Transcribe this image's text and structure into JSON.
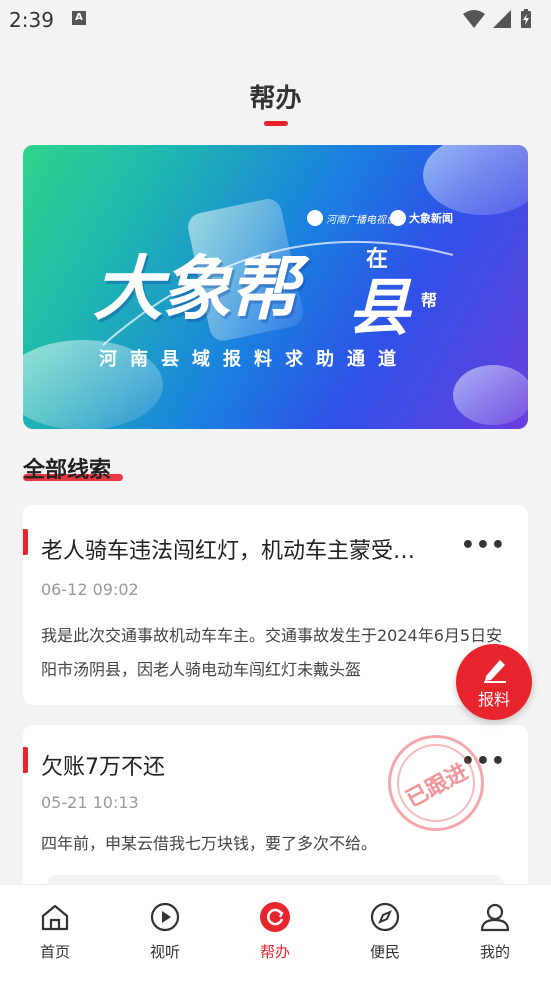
{
  "status_bar": {
    "time": "2:39",
    "notification_badge": "A"
  },
  "header": {
    "title": "帮办"
  },
  "banner": {
    "logo_left": "河南广播电视台",
    "logo_right": "大象新闻",
    "headline": "大象帮",
    "headline_tag_1": "在",
    "headline_tag_2": "县",
    "headline_tag_3": "帮",
    "subtitle": "河南县域报料求助通道"
  },
  "section": {
    "title": "全部线索"
  },
  "cards": [
    {
      "title": "老人骑车违法闯红灯，机动车主蒙受…",
      "time": "06-12 09:02",
      "body": "我是此次交通事故机动车车主。交通事故发生于2024年6月5日安阳市汤阴县，因老人骑电动车闯红灯未戴头盔",
      "more": "•••"
    },
    {
      "title": "欠账7万不还",
      "time": "05-21 10:13",
      "body": "四年前，申某云借我七万块钱，要了多次不给。",
      "more": "•••",
      "stamp": "已跟进"
    }
  ],
  "fab": {
    "label": "报料"
  },
  "tabs": [
    {
      "label": "首页",
      "icon": "home-icon",
      "active": false
    },
    {
      "label": "视听",
      "icon": "play-icon",
      "active": false
    },
    {
      "label": "帮办",
      "icon": "help-icon",
      "active": true
    },
    {
      "label": "便民",
      "icon": "compass-icon",
      "active": false
    },
    {
      "label": "我的",
      "icon": "user-icon",
      "active": false
    }
  ],
  "colors": {
    "accent": "#e8242c",
    "background": "#f3f3f3"
  }
}
